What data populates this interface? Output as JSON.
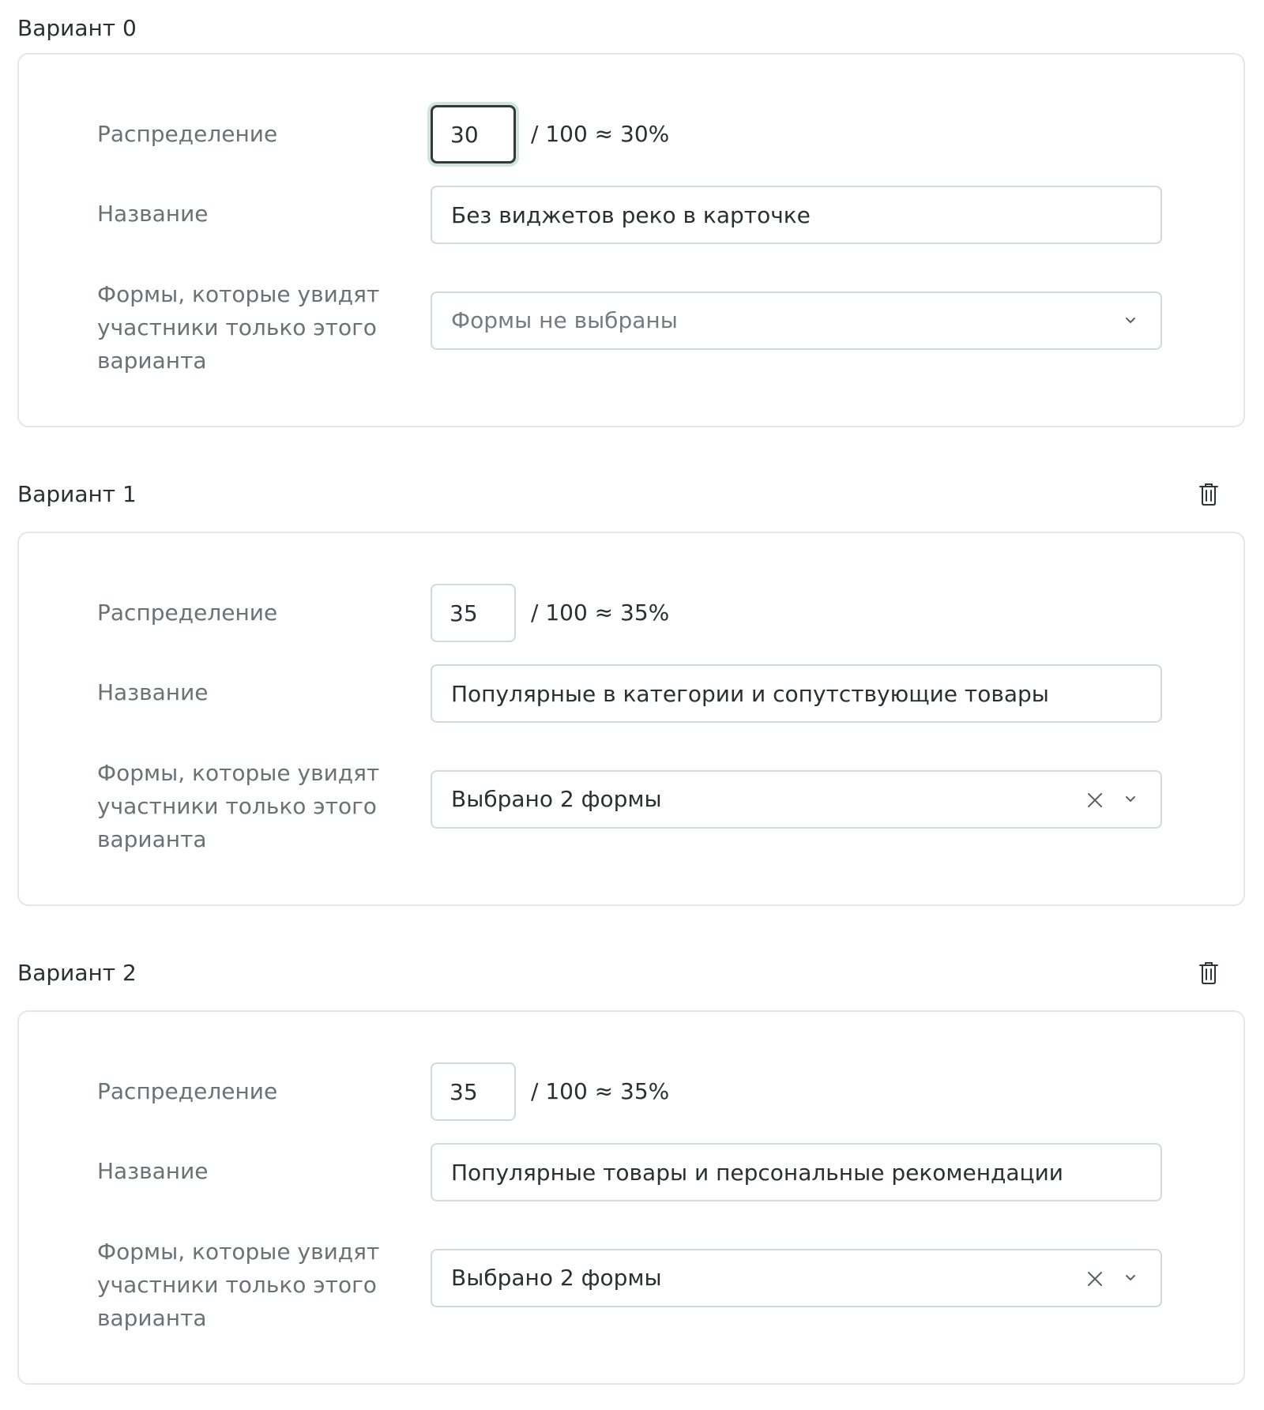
{
  "labels": {
    "distribution": "Распределение",
    "name": "Название",
    "forms": "Формы, которые увидят участники только этого варианта"
  },
  "colors": {
    "focus_ring": "#cfe6dd",
    "border": "#d3d9db",
    "label_text": "#6a7276",
    "text": "#2b2f31"
  },
  "variants": [
    {
      "title": "Вариант 0",
      "deletable": false,
      "distribution_value": "30",
      "distribution_suffix": "/ 100 ≈ 30%",
      "distribution_focused": true,
      "name_value": "Без виджетов реко в карточке",
      "forms_value": "Формы не выбраны",
      "forms_is_placeholder": true,
      "forms_clearable": false
    },
    {
      "title": "Вариант 1",
      "deletable": true,
      "distribution_value": "35",
      "distribution_suffix": "/ 100 ≈ 35%",
      "distribution_focused": false,
      "name_value": "Популярные в категории и сопутствующие товары",
      "forms_value": "Выбрано 2 формы",
      "forms_is_placeholder": false,
      "forms_clearable": true
    },
    {
      "title": "Вариант 2",
      "deletable": true,
      "distribution_value": "35",
      "distribution_suffix": "/ 100 ≈ 35%",
      "distribution_focused": false,
      "name_value": "Популярные товары и персональные рекомендации",
      "forms_value": "Выбрано 2 формы",
      "forms_is_placeholder": false,
      "forms_clearable": true
    }
  ],
  "icons": {
    "delete": "trash-icon",
    "clear": "close-icon",
    "expand": "chevron-down-icon"
  }
}
